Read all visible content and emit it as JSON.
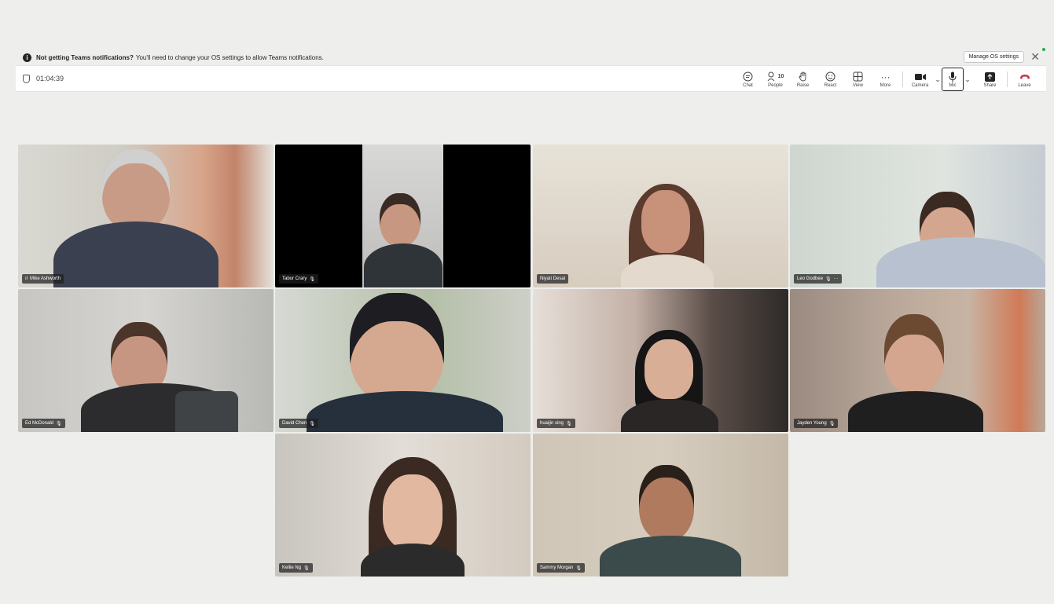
{
  "notification": {
    "bold_text": "Not getting Teams notifications?",
    "text": "You'll need to change your OS settings to allow Teams notifications.",
    "button": "Manage OS settings"
  },
  "meeting": {
    "timer": "01:04:39"
  },
  "toolbar": {
    "chat": "Chat",
    "people": "People",
    "people_count": "10",
    "raise": "Raise",
    "react": "React",
    "view": "View",
    "more": "More",
    "camera": "Camera",
    "mic": "Mic",
    "share": "Share",
    "leave": "Leave"
  },
  "participants": [
    {
      "name": "Mike Ashworth",
      "muted": false,
      "speaking": true
    },
    {
      "name": "Tabor Crary",
      "muted": true
    },
    {
      "name": "Niyati Desai",
      "muted": false
    },
    {
      "name": "Leo Godbee",
      "muted": true,
      "more": "···"
    },
    {
      "name": "Ed McDonald",
      "muted": true
    },
    {
      "name": "David Chen",
      "muted": true
    },
    {
      "name": "huaijin xing",
      "muted": true
    },
    {
      "name": "Jayden Young",
      "muted": true
    },
    {
      "name": "Kellie Ng",
      "muted": true
    },
    {
      "name": "Sammy Morgan",
      "muted": true
    }
  ]
}
